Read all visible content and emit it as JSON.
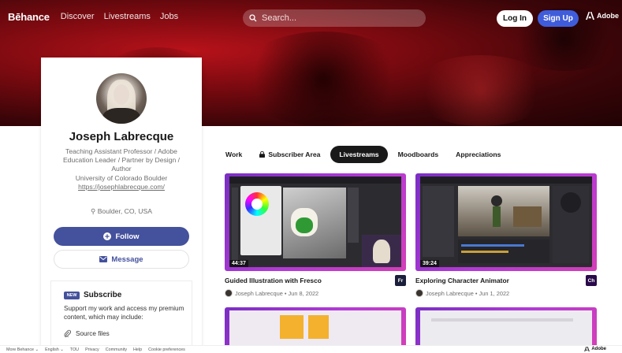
{
  "nav": {
    "logo": "Bēhance",
    "links": [
      "Discover",
      "Livestreams",
      "Jobs"
    ],
    "search_placeholder": "Search...",
    "login_label": "Log In",
    "signup_label": "Sign Up",
    "adobe_label": "Adobe"
  },
  "profile": {
    "name": "Joseph Labrecque",
    "bio_lines": [
      "Teaching Assistant Professor / Adobe",
      "Education Leader / Partner by Design /",
      "Author"
    ],
    "organization": "University of Colorado Boulder",
    "website": "https://josephlabrecque.com/",
    "location": "Boulder, CO, USA",
    "follow_label": "Follow",
    "message_label": "Message"
  },
  "subscribe": {
    "badge": "NEW",
    "title": "Subscribe",
    "text": "Support my work and access my premium content, which may include:",
    "item": "Source files"
  },
  "tabs": [
    {
      "label": "Work"
    },
    {
      "label": "Subscriber Area"
    },
    {
      "label": "Livestreams"
    },
    {
      "label": "Moodboards"
    },
    {
      "label": "Appreciations"
    }
  ],
  "projects": [
    {
      "title": "Guided Illustration with Fresco",
      "author": "Joseph Labrecque",
      "date": "Jun 8, 2022",
      "duration": "44:37",
      "app": "Fr",
      "app_color": "#1b1f3a"
    },
    {
      "title": "Exploring Character Animator",
      "author": "Joseph Labrecque",
      "date": "Jun 1, 2022",
      "duration": "39:24",
      "app": "Ch",
      "app_color": "#2a0a4a"
    }
  ],
  "footer": {
    "links": [
      "More Behance ⌄",
      "English ⌄",
      "TOU",
      "Privacy",
      "Community",
      "Help",
      "Cookie preferences"
    ],
    "adobe": "Adobe"
  }
}
